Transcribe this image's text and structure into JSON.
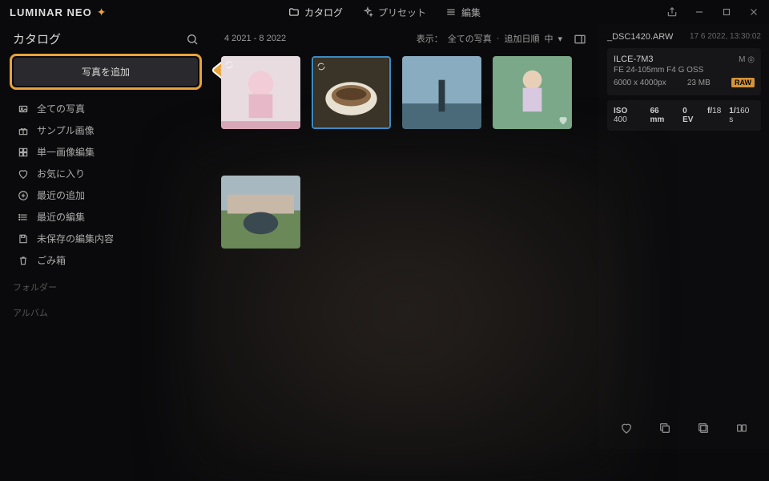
{
  "brand": {
    "text": "LUMINAR NEO"
  },
  "topnav": {
    "catalog": "カタログ",
    "presets": "プリセット",
    "edit": "編集"
  },
  "sidebar": {
    "title": "カタログ",
    "add_button": "写真を追加",
    "items": [
      {
        "label": "全ての写真"
      },
      {
        "label": "サンプル画像"
      },
      {
        "label": "単一画像編集"
      },
      {
        "label": "お気に入り"
      },
      {
        "label": "最近の追加"
      },
      {
        "label": "最近の編集"
      },
      {
        "label": "未保存の編集内容"
      },
      {
        "label": "ごみ箱"
      }
    ],
    "groups": {
      "folders": "フォルダー",
      "albums": "アルバム"
    }
  },
  "content": {
    "date_range": "4 2021 - 8 2022",
    "view_label": "表示：",
    "view_all": "全ての写真",
    "sort": "追加日順",
    "size": "中"
  },
  "info": {
    "filename": "_DSC1420.ARW",
    "datetime": "17 6 2022, 13:30:02",
    "camera": "ILCE-7M3",
    "m_label": "M",
    "lens": "FE 24-105mm F4 G OSS",
    "dims": "6000 x 4000px",
    "filesize": "23 MB",
    "raw": "RAW",
    "iso_label": "ISO",
    "iso": "400",
    "focal": "66 mm",
    "ev": "0 EV",
    "ap_label": "f/",
    "aperture": "18",
    "shutter_pre": "1/",
    "shutter": "160",
    "shutter_suf": "s"
  }
}
